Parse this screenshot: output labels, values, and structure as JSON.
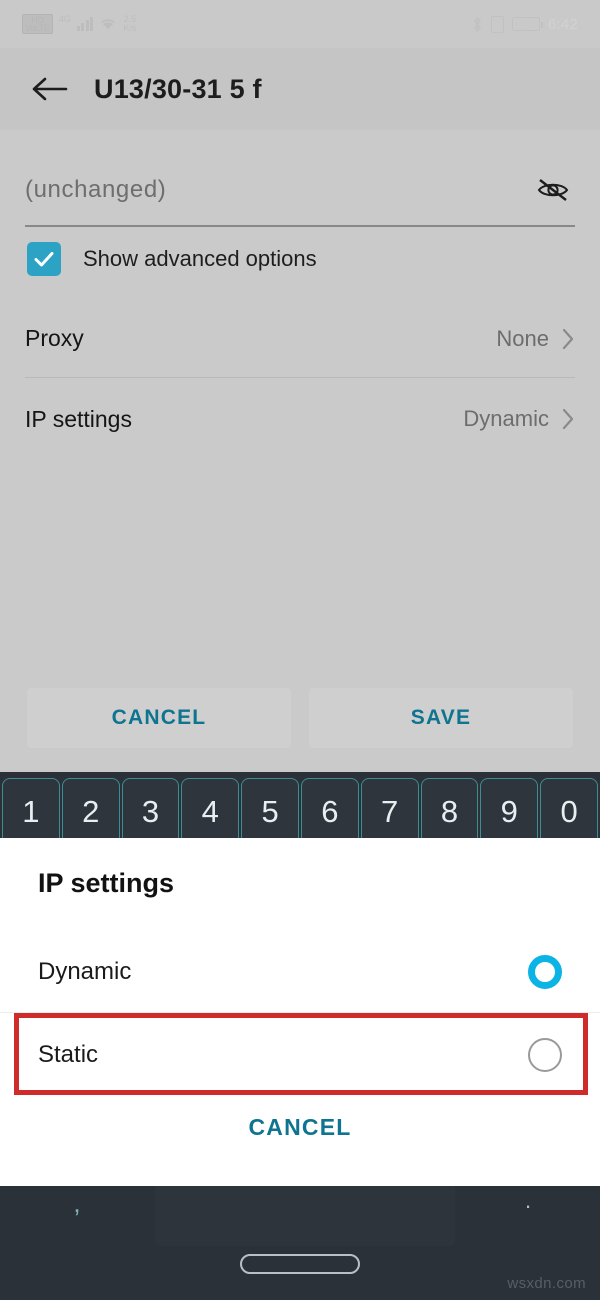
{
  "statusbar": {
    "network_badge_top": "HD",
    "network_badge_bottom": "VoLTE",
    "network_type": "4G",
    "signal_icon": "signal-bars-icon",
    "wifi_icon": "wifi-icon",
    "data_rate_value": "2.5",
    "data_rate_unit": "K/s",
    "bluetooth_icon": "bluetooth-icon",
    "vibrate_icon": "vibrate-icon",
    "battery_level": "46",
    "time": "6:42"
  },
  "appbar": {
    "back_icon": "back-arrow-icon",
    "title": "U13/30-31 5 f"
  },
  "form": {
    "password_placeholder": "(unchanged)",
    "password_value": "",
    "visibility_icon": "eye-off-icon",
    "advanced_checkbox_label": "Show advanced options",
    "advanced_checkbox_checked": true,
    "rows": [
      {
        "label": "Proxy",
        "value": "None",
        "chevron": "chevron-right-icon"
      },
      {
        "label": "IP settings",
        "value": "Dynamic",
        "chevron": "chevron-right-icon"
      }
    ]
  },
  "actions": {
    "cancel_label": "CANCEL",
    "save_label": "SAVE"
  },
  "keyboard": {
    "number_row": [
      "1",
      "2",
      "3",
      "4",
      "5",
      "6",
      "7",
      "8",
      "9",
      "0"
    ],
    "comma_key": ",",
    "period_key": "."
  },
  "dialog": {
    "title": "IP settings",
    "options": [
      {
        "label": "Dynamic",
        "selected": true
      },
      {
        "label": "Static",
        "selected": false
      }
    ],
    "cancel_label": "CANCEL"
  },
  "annotation": {
    "target": "Static",
    "color": "#cf2b2b"
  },
  "watermark": "wsxdn.com",
  "colors": {
    "accent_teal": "#0e7490",
    "checkbox_blue": "#2ca3c4",
    "radio_cyan": "#0bb4e4",
    "page_background": "#c9c9c9",
    "dialog_background": "#ffffff",
    "keyboard_background": "#2a3139",
    "key_border": "#3f8d94",
    "annotation_red": "#cf2b2b"
  }
}
